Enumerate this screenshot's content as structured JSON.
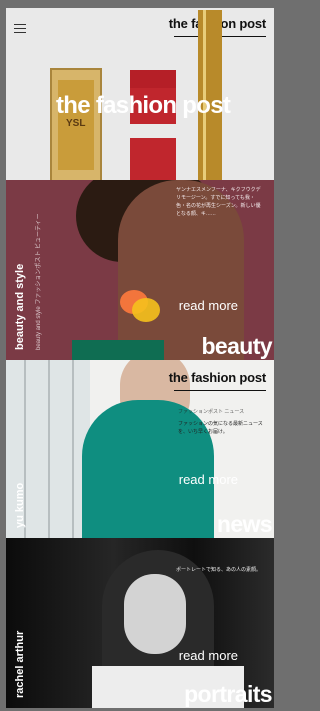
{
  "brand": {
    "name": "the fashion post",
    "hero": "the fashion post"
  },
  "panels": {
    "p1": {
      "ysl_mark": "YSL"
    },
    "p2": {
      "side_category": "beauty and style",
      "side_small": "beauty and style ファッションポスト ビューティー",
      "jp_text": "ヤンナエスメンフーナ、キクフウクデリモージーン。すでに知っても我・色・名の花が再生シーズン。新しい優となる顔、キ……",
      "read_more": "read more",
      "big_category": "beauty"
    },
    "p3": {
      "brand_name": "the fashion post",
      "side_category": "yu kumo",
      "jp_text": "ファッションの気になる最新ニュースを、いち早くお届け。",
      "nav_muted": "ファッションポスト ニュース",
      "read_more": "read more",
      "big_category": "news"
    },
    "p4": {
      "side_category": "rachel arthur",
      "jp_text": "ポートレートで知る、あの人の素顔。",
      "read_more": "read more",
      "big_category": "portraits"
    }
  }
}
